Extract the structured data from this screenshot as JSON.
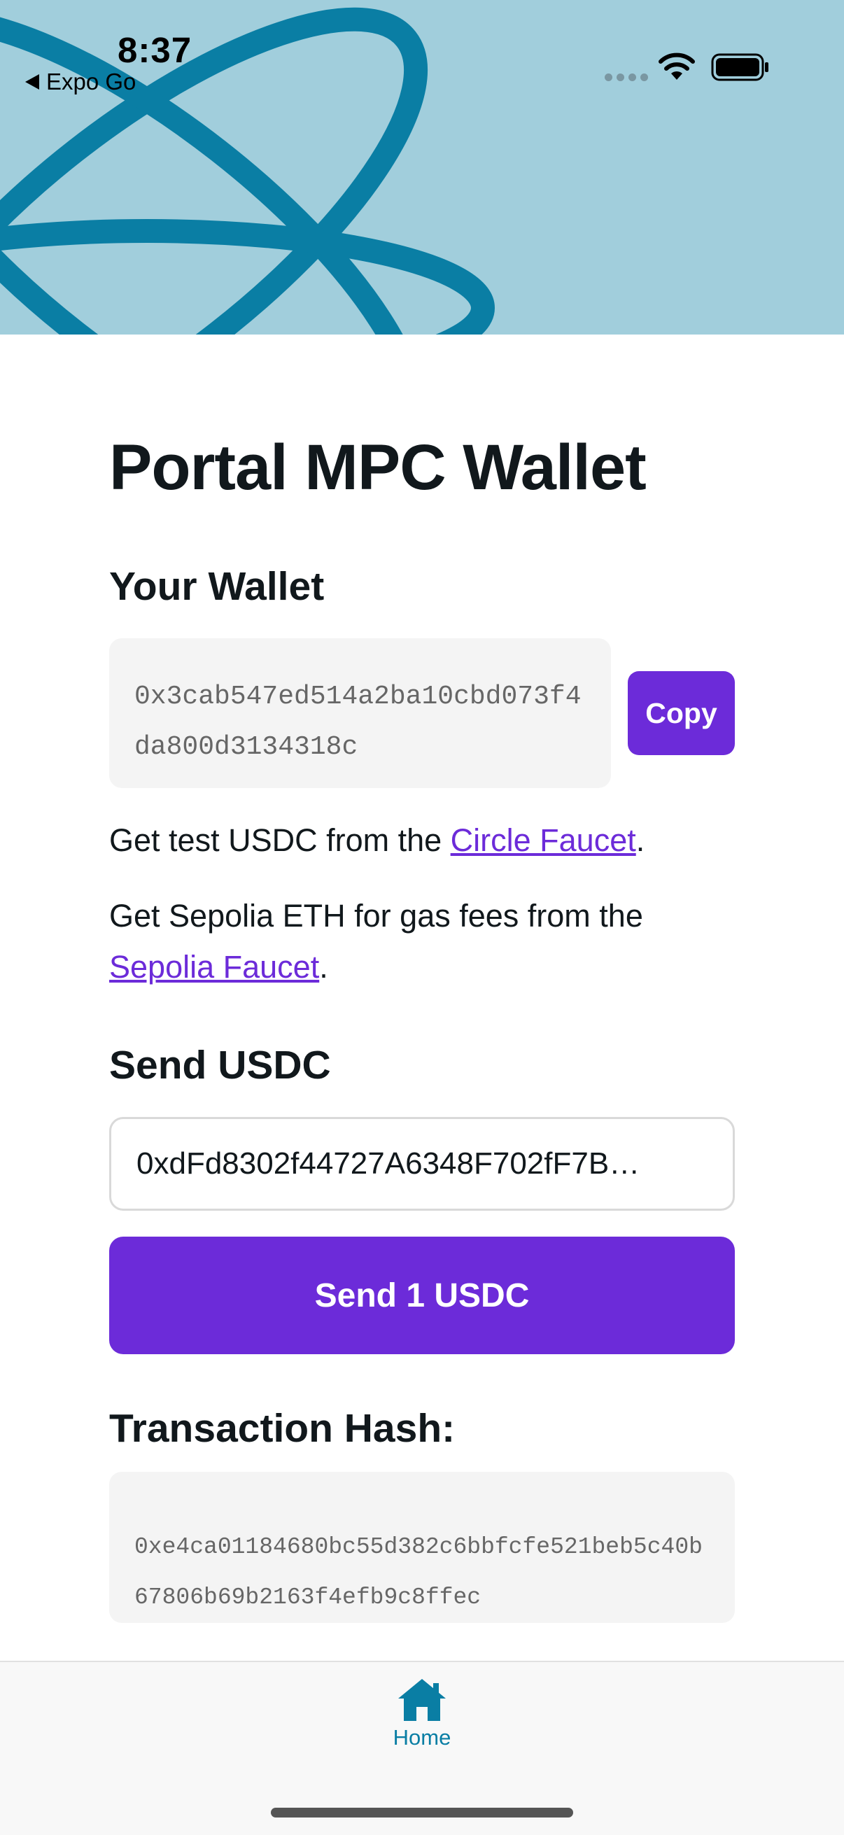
{
  "status_bar": {
    "time": "8:37",
    "back_label": "Expo Go"
  },
  "page": {
    "title": "Portal MPC Wallet"
  },
  "wallet": {
    "heading": "Your Wallet",
    "address": "0x3cab547ed514a2ba10cbd073f4da800d3134318c",
    "copy_label": "Copy"
  },
  "faucets": {
    "usdc_prefix": "Get test USDC from the ",
    "usdc_link": "Circle Faucet",
    "usdc_suffix": ".",
    "eth_prefix": "Get Sepolia ETH for gas fees from the ",
    "eth_link": "Sepolia Faucet",
    "eth_suffix": "."
  },
  "send": {
    "heading": "Send USDC",
    "recipient_value": "0xdFd8302f44727A6348F702fF7B…",
    "button_label": "Send 1 USDC"
  },
  "transaction": {
    "heading": "Transaction Hash:",
    "hash": "0xe4ca01184680bc55d382c6bbfcfe521beb5c40b67806b69b2163f4efb9c8ffec"
  },
  "tab_bar": {
    "tabs": [
      {
        "label": "Home",
        "icon": "home-icon",
        "active": true
      }
    ]
  },
  "colors": {
    "header_bg": "#a1cedc",
    "header_logo": "#0a7ea4",
    "accent": "#6c2bd9",
    "tab_active": "#0a7ea4"
  }
}
